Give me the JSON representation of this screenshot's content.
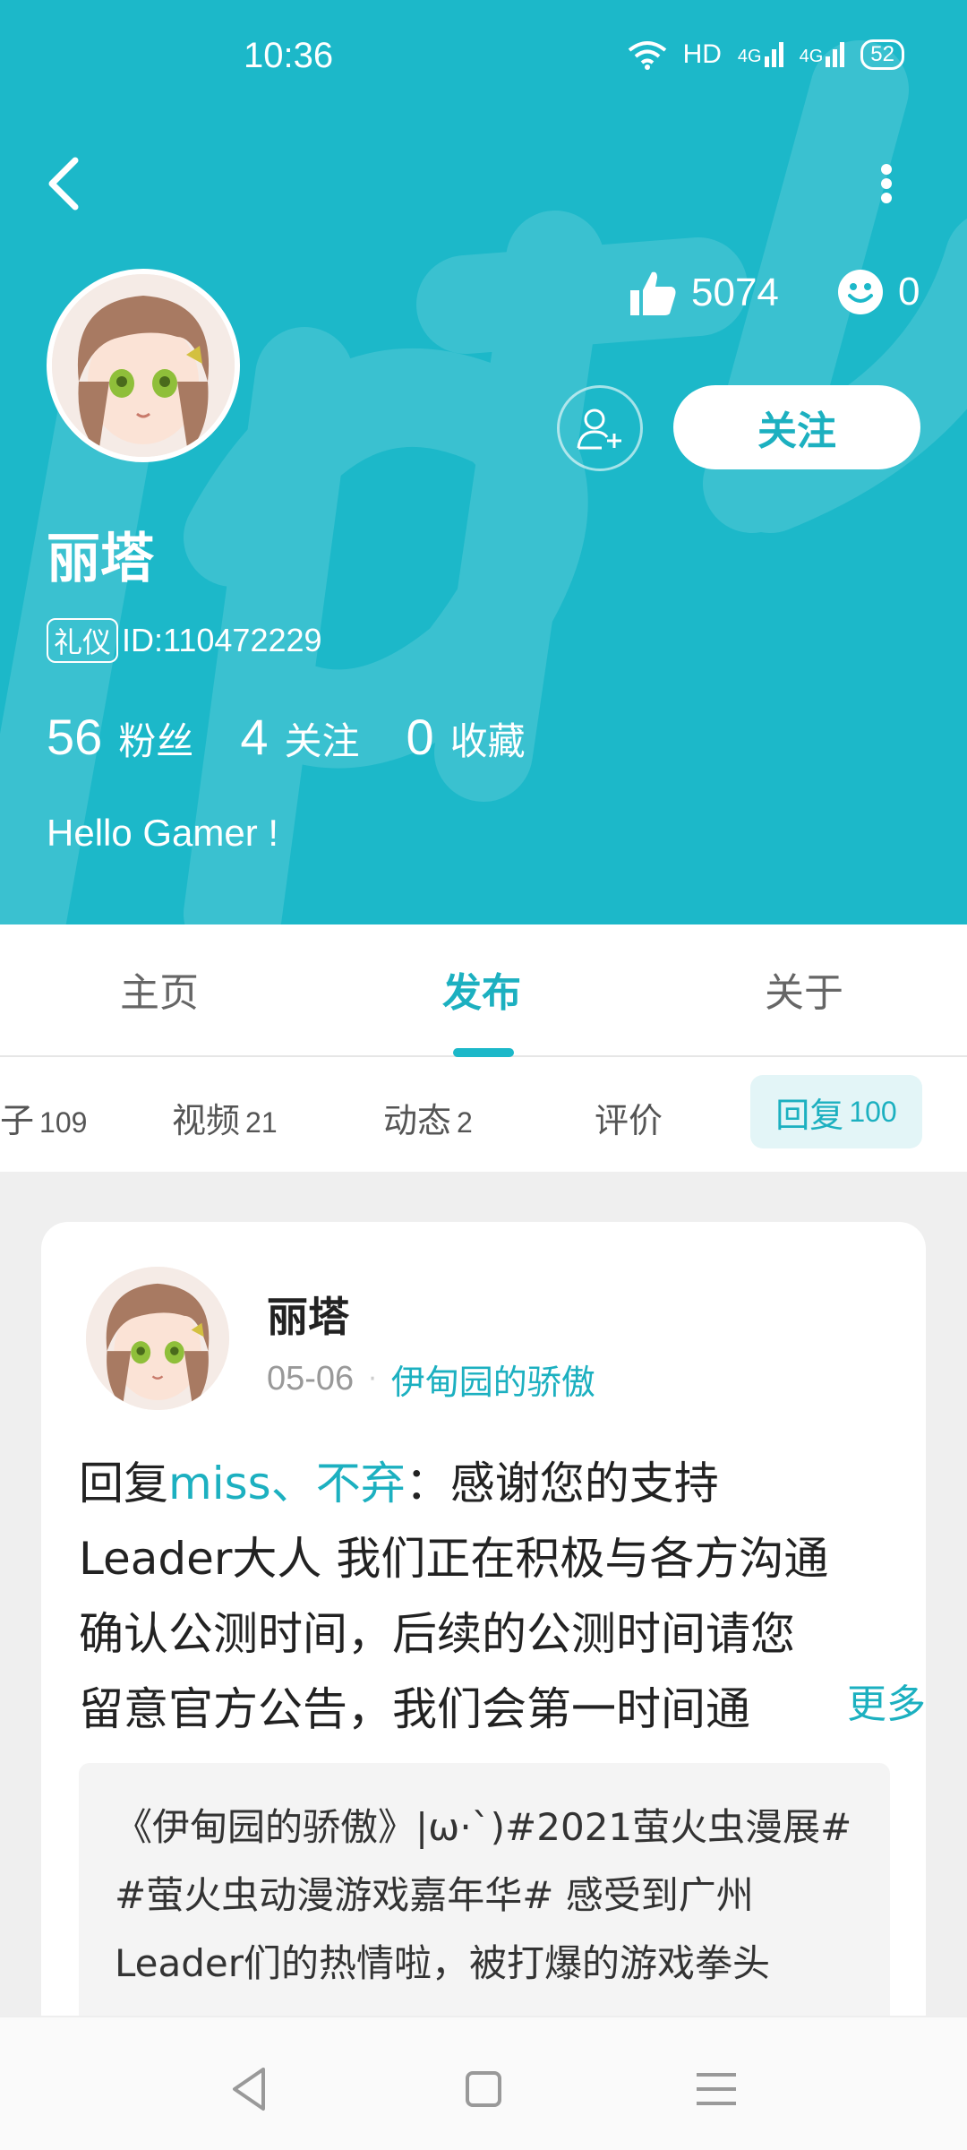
{
  "status": {
    "time": "10:36",
    "network": "HD",
    "signal1": "4G",
    "signal2": "4G",
    "battery": "52"
  },
  "profile": {
    "name": "丽塔",
    "badge": "礼仪",
    "id": "ID:110472229",
    "likes": "5074",
    "smiles": "0",
    "follow_label": "关注",
    "stats": [
      {
        "num": "56",
        "label": "粉丝"
      },
      {
        "num": "4",
        "label": "关注"
      },
      {
        "num": "0",
        "label": "收藏"
      }
    ],
    "bio": "Hello Gamer !"
  },
  "tabs": [
    {
      "label": "主页"
    },
    {
      "label": "发布"
    },
    {
      "label": "关于"
    }
  ],
  "subtabs": [
    {
      "label": "子",
      "count": "109"
    },
    {
      "label": "视频",
      "count": "21"
    },
    {
      "label": "动态",
      "count": "2"
    },
    {
      "label": "评价",
      "count": ""
    },
    {
      "label": "回复",
      "count": "100"
    }
  ],
  "post": {
    "author": "丽塔",
    "date": "05-06",
    "dot": "·",
    "game": "伊甸园的骄傲",
    "reply_prefix": "回复",
    "reply_target": "miss、不弃",
    "line1_rest": "：感谢您的支持",
    "line2": "Leader大人 我们正在积极与各方沟通",
    "line3": "确认公测时间，后续的公测时间请您",
    "line4": "留意官方公告，我们会第一时间通",
    "more_label": "更多",
    "quote_lines": [
      "《伊甸园的骄傲》|ω·`)#2021萤火虫漫展#",
      "#萤火虫动漫游戏嘉年华# 感受到广州",
      "Leader们的热情啦，被打爆的游戏拳头"
    ]
  }
}
